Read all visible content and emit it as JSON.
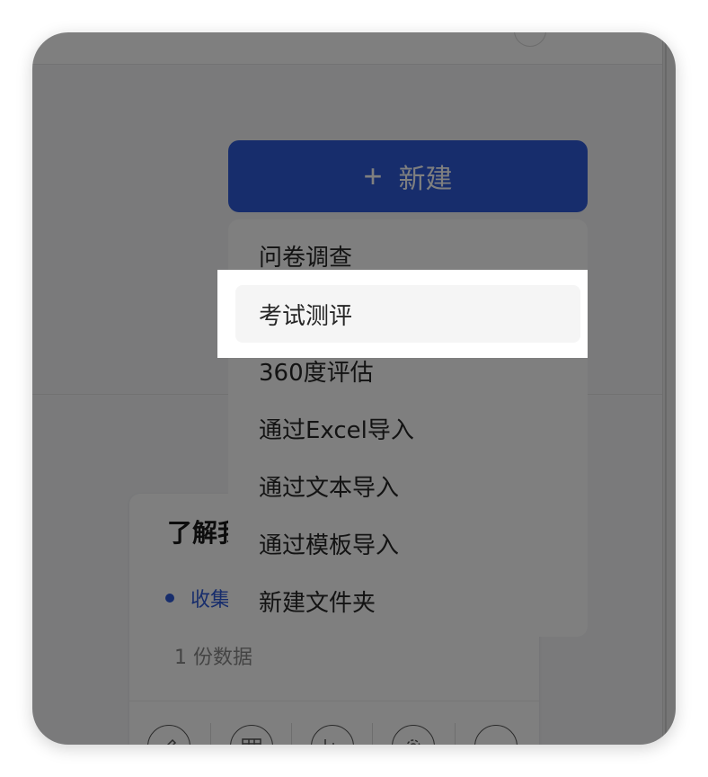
{
  "new_button": {
    "plus": "+",
    "label": "新建",
    "color": "#2f5bd8"
  },
  "card": {
    "title": "了解我",
    "status": "收集",
    "count_text": "1 份数据",
    "toolbar_icons": [
      "edit-icon",
      "table-icon",
      "chart-icon",
      "settings-icon",
      "more-icon"
    ]
  },
  "menu": {
    "items": [
      {
        "label": "问卷调查"
      },
      {
        "label": "考试测评"
      },
      {
        "label": "360度评估"
      },
      {
        "label": "通过Excel导入"
      },
      {
        "label": "通过文本导入"
      },
      {
        "label": "通过模板导入"
      },
      {
        "label": "新建文件夹"
      }
    ],
    "highlighted_index": 1
  }
}
